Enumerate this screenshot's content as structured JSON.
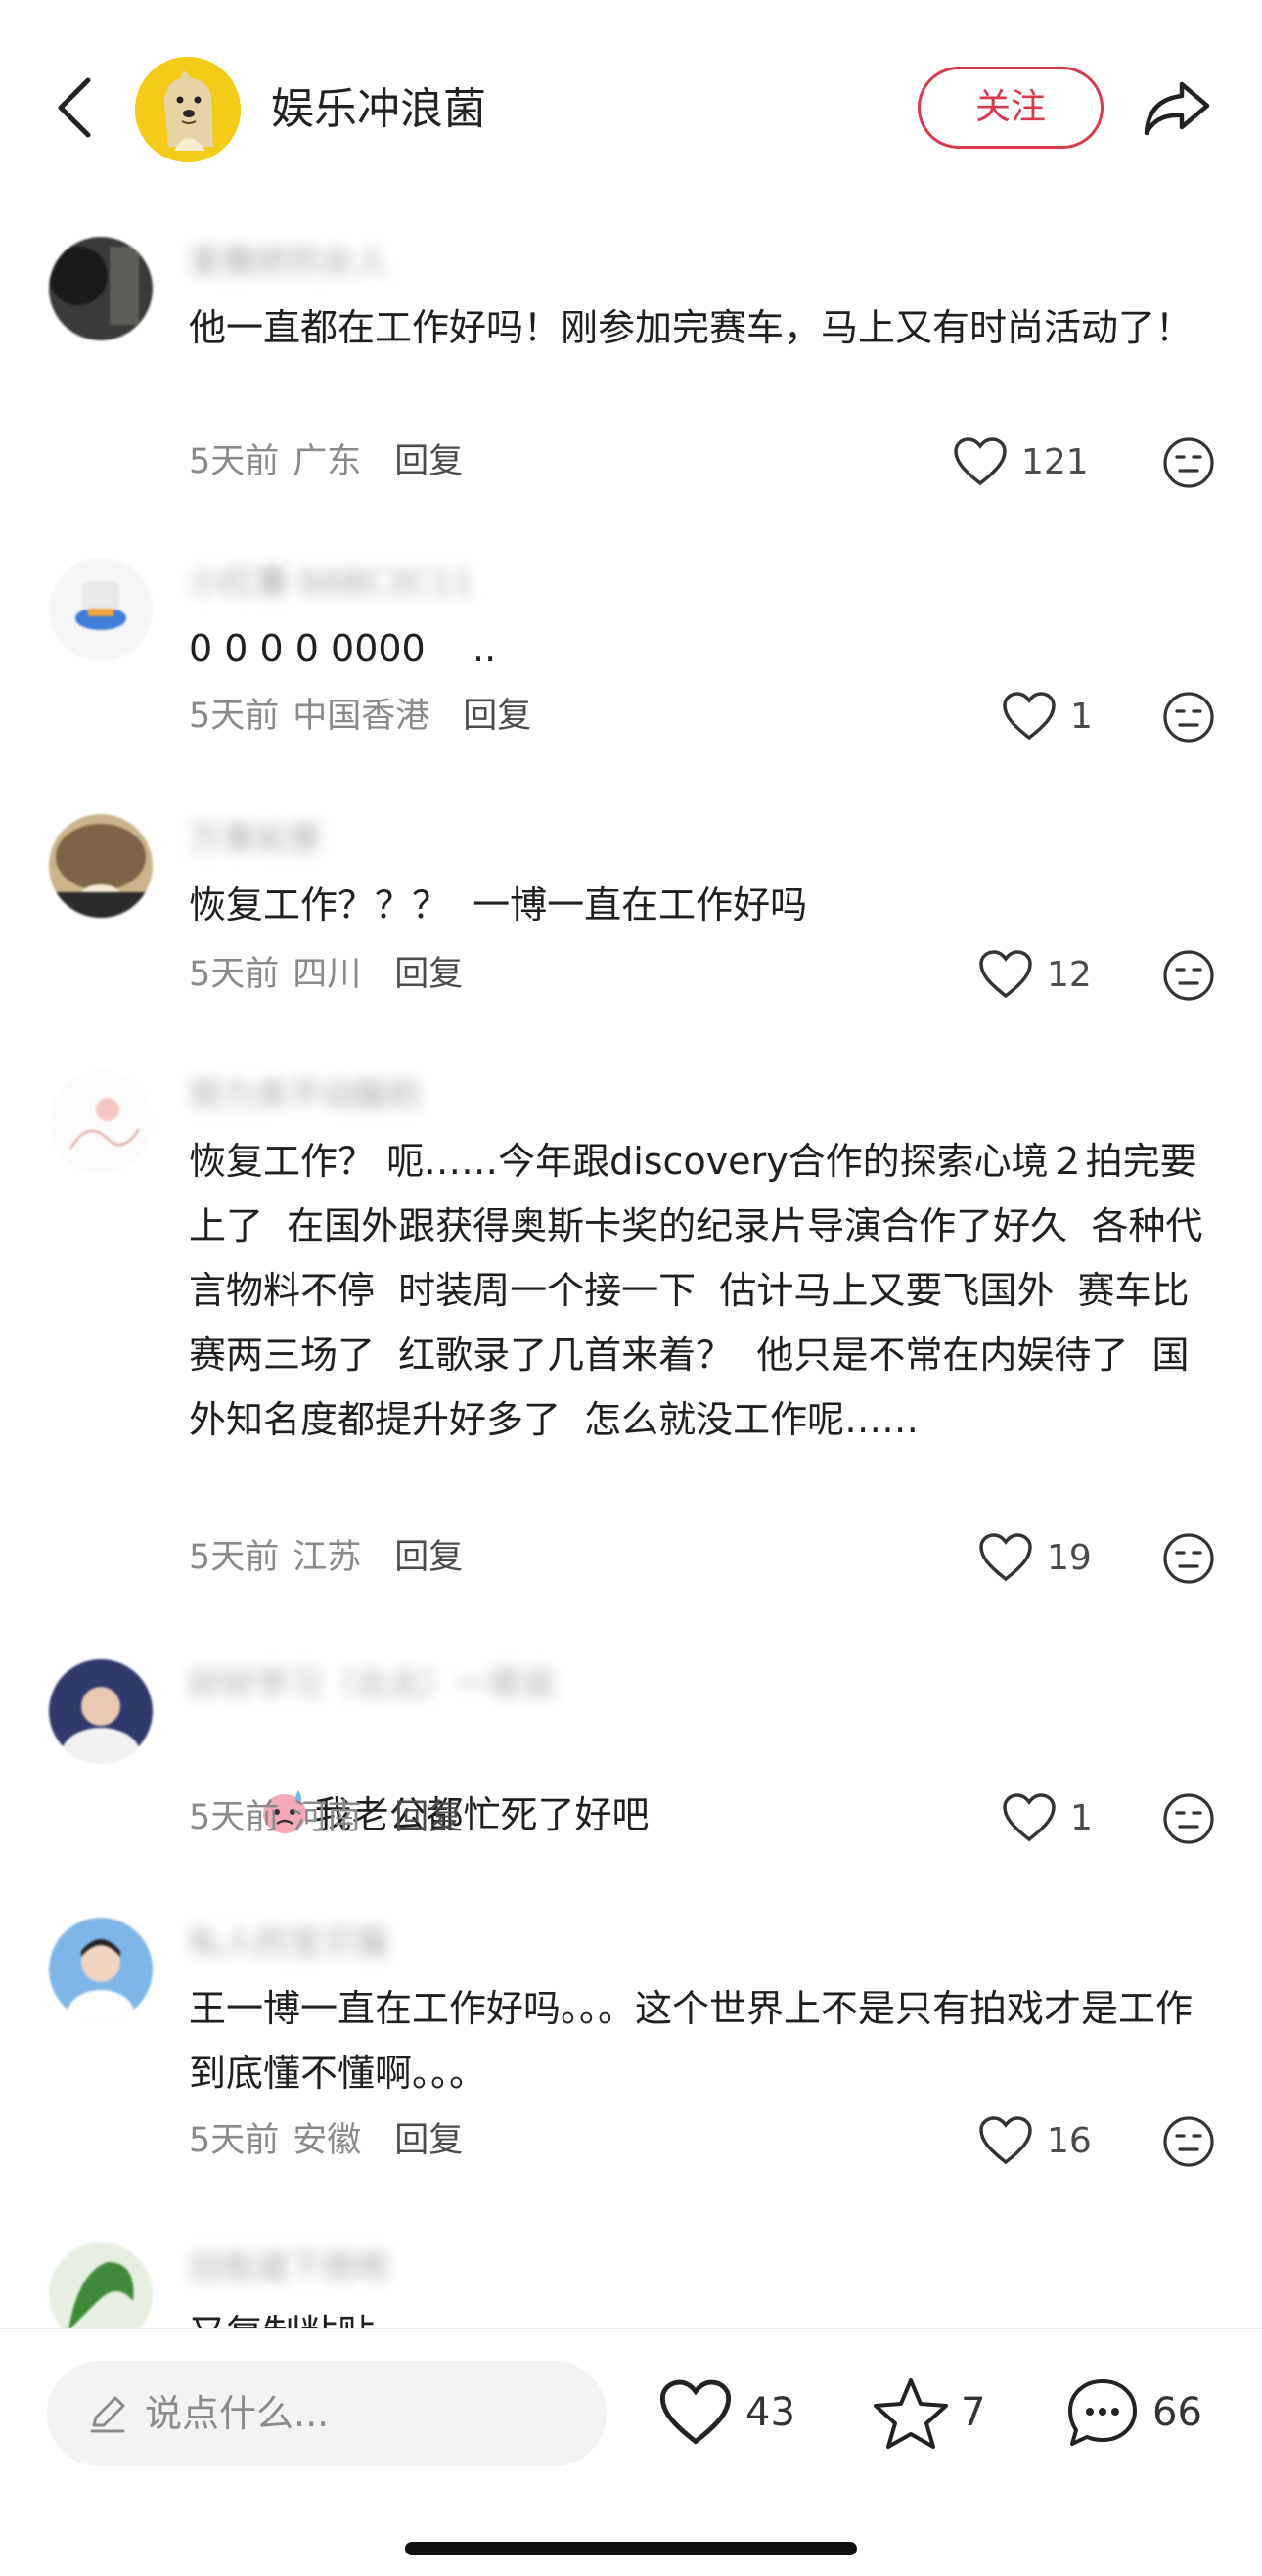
{
  "header": {
    "author_name": "娱乐冲浪菌",
    "follow_label": "关注"
  },
  "comments": [
    {
      "user": "爱撒娇的女人",
      "text": "他一直都在工作好吗！刚参加完赛车，马上又有时尚活动了！",
      "time": "5天前",
      "location": "广东",
      "reply_label": "回复",
      "likes": "121"
    },
    {
      "user": "小红薯 66BC3C11",
      "text": "0 0 0 0 0000    ..",
      "time": "5天前",
      "location": "中国香港",
      "reply_label": "回复",
      "likes": "1"
    },
    {
      "user": "万事如意",
      "text": "恢复工作？？？  一博一直在工作好吗",
      "time": "5天前",
      "location": "四川",
      "reply_label": "回复",
      "likes": "12"
    },
    {
      "user": "努力卖不动酸奶",
      "text": "恢复工作？ 呃……今年跟discovery合作的探索心境２拍完要上了  在国外跟获得奥斯卡奖的纪录片导演合作了好久  各种代言物料不停  时装周一个接一下  估计马上又要飞国外  赛车比赛两三场了  红歌录了几首来着？  他只是不常在内娱待了  国外知名度都提升好多了  怎么就没工作呢……",
      "time": "5天前",
      "location": "江苏",
      "reply_label": "回复",
      "likes": "19"
    },
    {
      "user": "好好学习（北北）一哥说",
      "text": "我老公都忙死了好吧",
      "time": "5天前",
      "location": "河南",
      "reply_label": "回复",
      "likes": "1"
    },
    {
      "user": "私人的宝贝猫",
      "text": "王一博一直在工作好吗。。。这个世界上不是只有拍戏才是工作到底懂不懂啊。。。",
      "time": "5天前",
      "location": "安徽",
      "reply_label": "回复",
      "likes": "16"
    },
    {
      "user": "旧街道下雨吧",
      "text": "又复制粘贴"
    }
  ],
  "bottom_bar": {
    "input_placeholder": "说点什么...",
    "like_count": "43",
    "star_count": "7",
    "comment_count": "66"
  },
  "colors": {
    "accent": "#d9394b",
    "meta_text": "#8a8a8a",
    "avatar_author": "#f4cb17"
  },
  "icons": {
    "back": "chevron-left-icon",
    "share": "share-arrow-icon",
    "like": "heart-icon",
    "emoji": "neutral-face-icon",
    "pencil": "pencil-icon",
    "star": "star-icon",
    "chat": "chat-bubble-icon"
  }
}
